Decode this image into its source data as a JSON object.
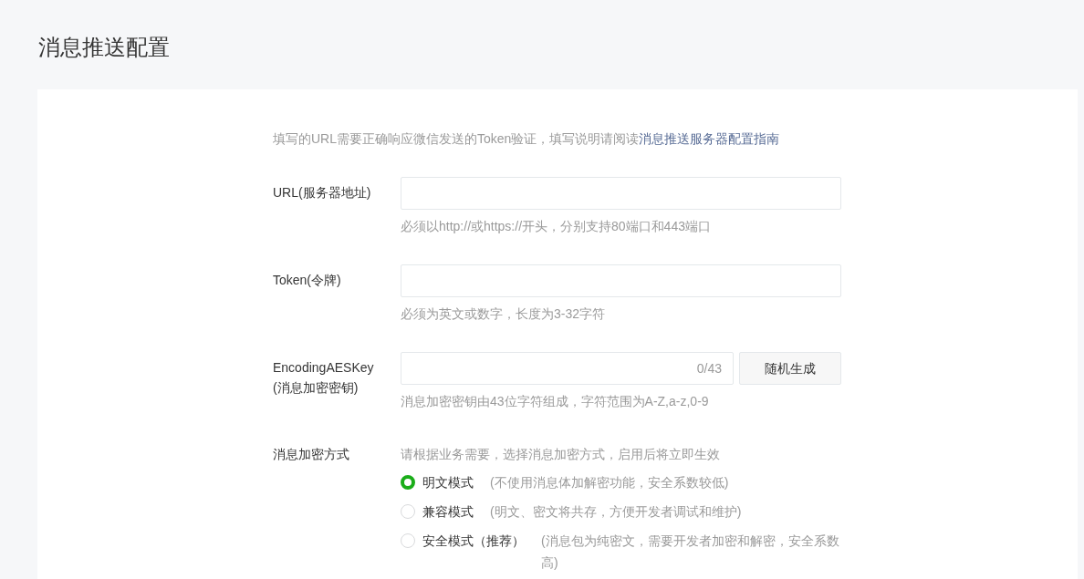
{
  "page_title": "消息推送配置",
  "intro": {
    "text": "填写的URL需要正确响应微信发送的Token验证，填写说明请阅读",
    "link": "消息推送服务器配置指南"
  },
  "fields": [
    {
      "label": "URL(服务器地址)",
      "hint": "必须以http://或https://开头，分别支持80端口和443端口"
    },
    {
      "label": "Token(令牌)",
      "hint": "必须为英文或数字，长度为3-32字符"
    },
    {
      "label": "EncodingAESKey",
      "label_2": "(消息加密密钥)",
      "counter": "0/43",
      "button": "随机生成",
      "hint": "消息加密密钥由43位字符组成，字符范围为A-Z,a-z,0-9"
    }
  ],
  "encryption": {
    "label": "消息加密方式",
    "hint": "请根据业务需要，选择消息加密方式，启用后将立即生效",
    "options": [
      {
        "label": "明文模式",
        "description": "(不使用消息体加解密功能，安全系数较低)",
        "selected": true
      },
      {
        "label": "兼容模式",
        "description": "(明文、密文将共存，方便开发者调试和维护)",
        "selected": false
      },
      {
        "label": "安全模式（推荐）",
        "description": "(消息包为纯密文，需要开发者加密和解密，安全系数高)",
        "selected": false
      }
    ]
  }
}
